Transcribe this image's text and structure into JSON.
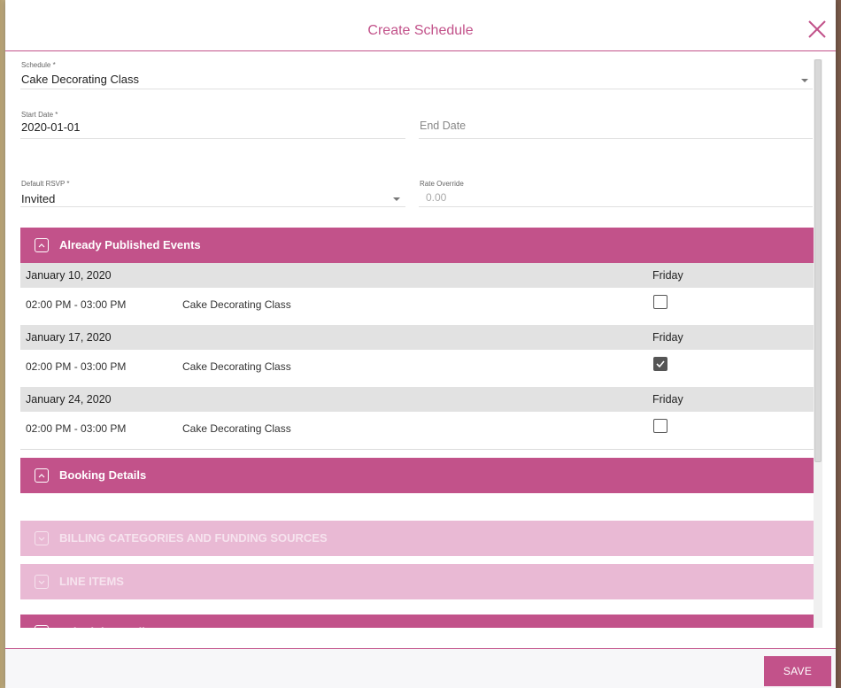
{
  "modal": {
    "title": "Create Schedule",
    "save_label": "SAVE"
  },
  "form": {
    "schedule": {
      "label": "Schedule *",
      "value": "Cake Decorating Class"
    },
    "start_date": {
      "label": "Start Date *",
      "value": "2020-01-01"
    },
    "end_date": {
      "placeholder": "End Date"
    },
    "default_rsvp": {
      "label": "Default RSVP *",
      "value": "Invited"
    },
    "rate_override": {
      "label": "Rate Override",
      "value": "0.00"
    }
  },
  "panels": {
    "published": "Already Published Events",
    "booking": "Booking Details",
    "billing": "BILLING CATEGORIES AND FUNDING SOURCES",
    "line_items": "LINE ITEMS",
    "schedule_details": "Schedule Details"
  },
  "events": [
    {
      "date": "January 10, 2020",
      "weekday": "Friday",
      "time": "02:00 PM - 03:00 PM",
      "name": "Cake Decorating Class",
      "checked": false
    },
    {
      "date": "January 17, 2020",
      "weekday": "Friday",
      "time": "02:00 PM - 03:00 PM",
      "name": "Cake Decorating Class",
      "checked": true
    },
    {
      "date": "January 24, 2020",
      "weekday": "Friday",
      "time": "02:00 PM - 03:00 PM",
      "name": "Cake Decorating Class",
      "checked": false
    }
  ],
  "colors": {
    "accent": "#c2528a",
    "accent_light": "#e9b9d4"
  }
}
